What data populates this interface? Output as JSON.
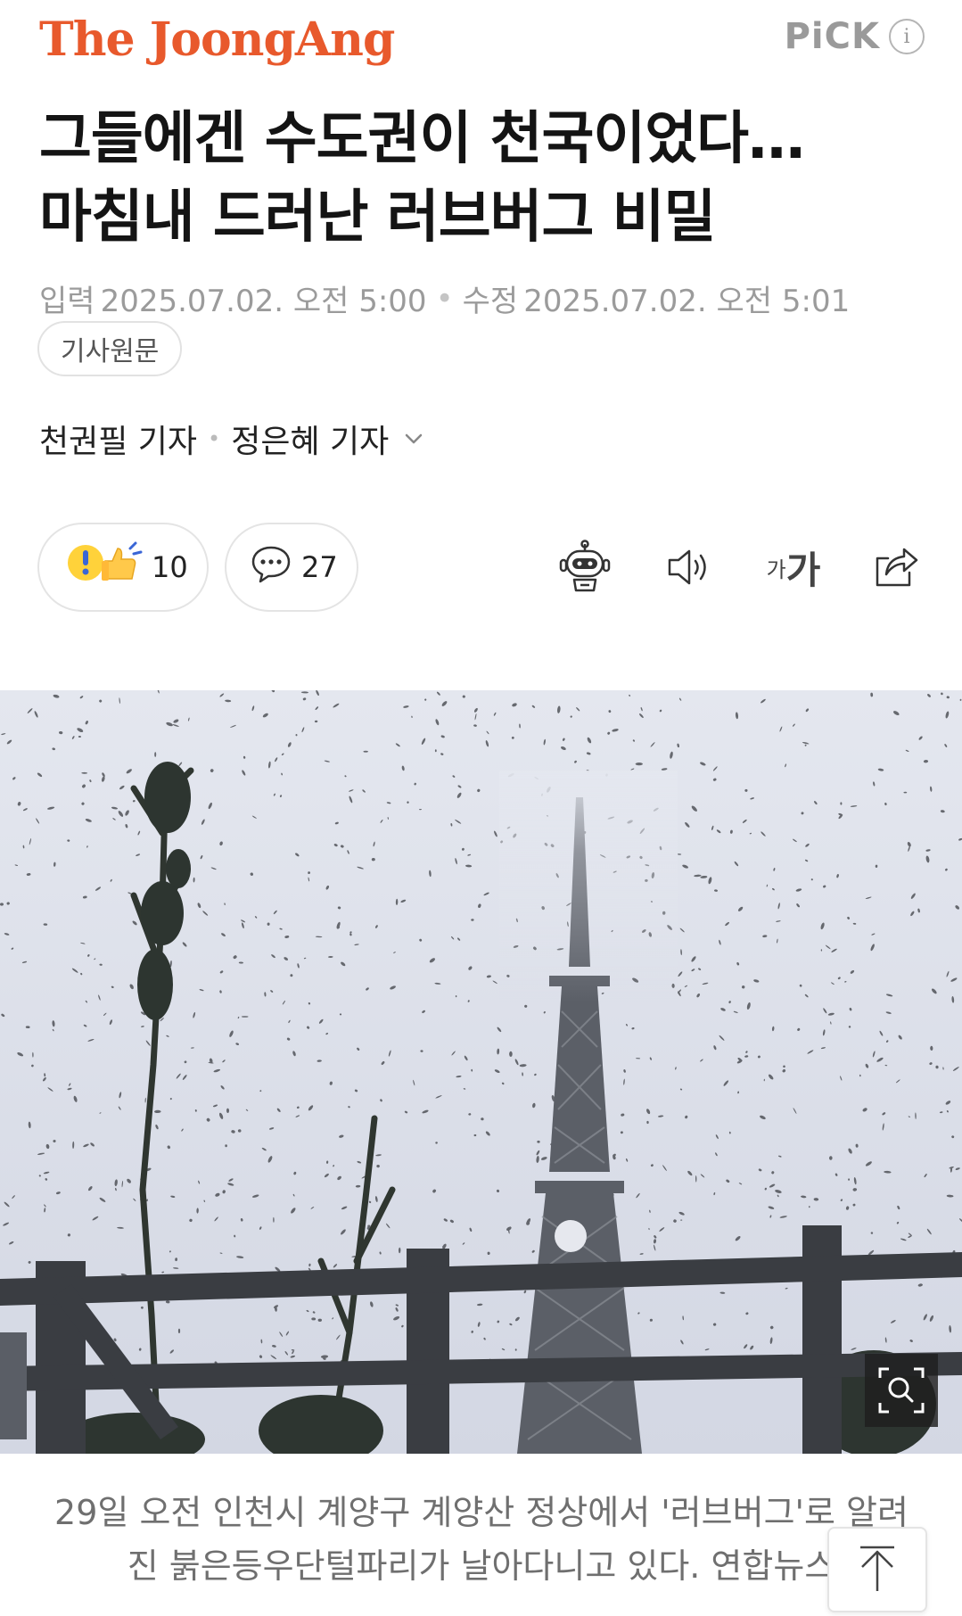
{
  "header": {
    "brand": "The JoongAng",
    "pick_label": "PiCK",
    "info_glyph": "i"
  },
  "article": {
    "headline_line1": "그들에겐 수도권이 천국이었다…",
    "headline_line2": "마침내 드러난 러브버그 비밀",
    "published_label": "입력",
    "published": "2025.07.02. 오전 5:00",
    "modified_label": "수정",
    "modified": "2025.07.02. 오전 5:01",
    "source_button": "기사원문",
    "authors": [
      "천권필 기자",
      "정은혜 기자"
    ]
  },
  "reactions": {
    "like_count": "10",
    "comment_count": "27"
  },
  "tools": {
    "font_small": "가",
    "font_big": "가",
    "icons": [
      "robot-summary-icon",
      "speaker-icon",
      "font-size-icon",
      "share-icon"
    ]
  },
  "photo": {
    "caption": "29일 오전 인천시 계양구 계양산 정상에서 '러브버그'로 알려진 붉은등우단털파리가 날아다니고 있다. 연합뉴스"
  },
  "colors": {
    "brand": "#e8592c",
    "muted_text": "#9b9b9b",
    "border": "#e2e2e2"
  }
}
